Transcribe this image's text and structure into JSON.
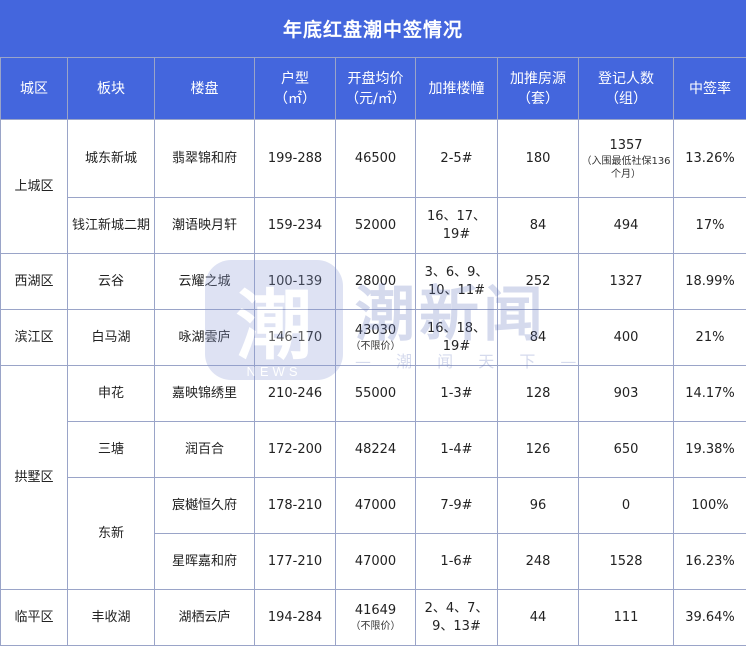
{
  "title": "年底红盘潮中签情况",
  "headers": {
    "district": "城区",
    "block": "板块",
    "project": "楼盘",
    "unit_type": [
      "户型",
      "（㎡）"
    ],
    "price": [
      "开盘均价",
      "（元/㎡）"
    ],
    "buildings": "加推楼幢",
    "units": [
      "加推房源",
      "（套）"
    ],
    "registrants": [
      "登记人数",
      "（组）"
    ],
    "rate": "中签率"
  },
  "rows": [
    {
      "district": "上城区",
      "block": "城东新城",
      "project": "翡翠锦和府",
      "size": "199-288",
      "price": "46500",
      "buildings": "2-5#",
      "units": "180",
      "registrants": "1357",
      "registrants_note": "（入围最低社保136个月）",
      "rate": "13.26%"
    },
    {
      "block": "钱江新城二期",
      "project": "潮语映月轩",
      "size": "159-234",
      "price": "52000",
      "buildings": "16、17、19#",
      "units": "84",
      "registrants": "494",
      "rate": "17%"
    },
    {
      "district": "西湖区",
      "block": "云谷",
      "project": "云耀之城",
      "size": "100-139",
      "price": "28000",
      "buildings": "3、6、9、10、11#",
      "units": "252",
      "registrants": "1327",
      "rate": "18.99%"
    },
    {
      "district": "滨江区",
      "block": "白马湖",
      "project": "咏湖雲庐",
      "size": "146-170",
      "price": "43030",
      "price_note": "（不限价）",
      "buildings": "16、18、19#",
      "units": "84",
      "registrants": "400",
      "rate": "21%"
    },
    {
      "district": "拱墅区",
      "block": "申花",
      "project": "嘉映锦绣里",
      "size": "210-246",
      "price": "55000",
      "buildings": "1-3#",
      "units": "128",
      "registrants": "903",
      "rate": "14.17%"
    },
    {
      "block": "三塘",
      "project": "润百合",
      "size": "172-200",
      "price": "48224",
      "buildings": "1-4#",
      "units": "126",
      "registrants": "650",
      "rate": "19.38%"
    },
    {
      "block": "东新",
      "project": "宸樾恒久府",
      "size": "178-210",
      "price": "47000",
      "buildings": "7-9#",
      "units": "96",
      "registrants": "0",
      "rate": "100%"
    },
    {
      "project": "星晖嘉和府",
      "size": "177-210",
      "price": "47000",
      "buildings": "1-6#",
      "units": "248",
      "registrants": "1528",
      "rate": "16.23%"
    },
    {
      "district": "临平区",
      "block": "丰收湖",
      "project": "湖栖云庐",
      "size": "194-284",
      "price": "41649",
      "price_note": "（不限价）",
      "buildings": "2、4、7、9、13#",
      "units": "44",
      "registrants": "111",
      "rate": "39.64%"
    }
  ],
  "watermark": {
    "badge_char": "潮",
    "badge_sub": "NEWS",
    "name": "潮新闻",
    "slogan": "— 潮 闻 天 下 —"
  }
}
